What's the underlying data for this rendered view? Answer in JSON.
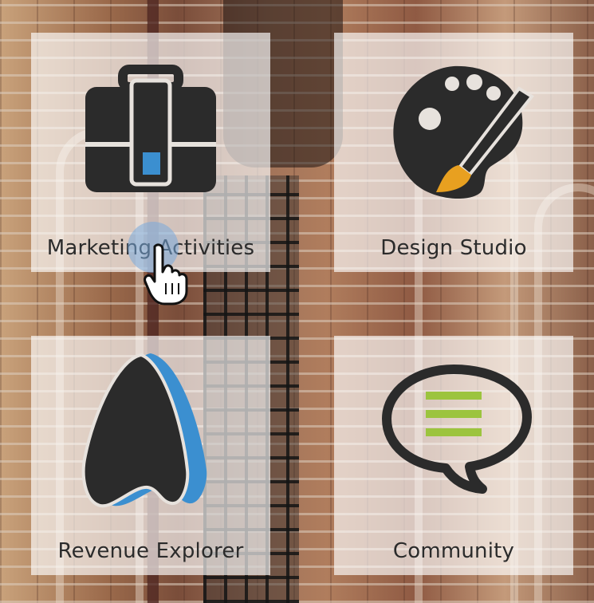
{
  "tiles": [
    {
      "label": "Marketing Activities",
      "icon": "briefcase-icon"
    },
    {
      "label": "Design Studio",
      "icon": "palette-icon"
    },
    {
      "label": "Revenue Explorer",
      "icon": "revenue-a-icon"
    },
    {
      "label": "Community",
      "icon": "speech-bubble-icon"
    }
  ],
  "colors": {
    "icon_dark": "#2b2b2b",
    "accent_blue": "#3b8fd0",
    "accent_orange": "#e8a020",
    "accent_green": "#9cc43e",
    "tile_bg": "rgba(255,255,255,0.66)"
  },
  "cursor": "hand-pointer-icon"
}
